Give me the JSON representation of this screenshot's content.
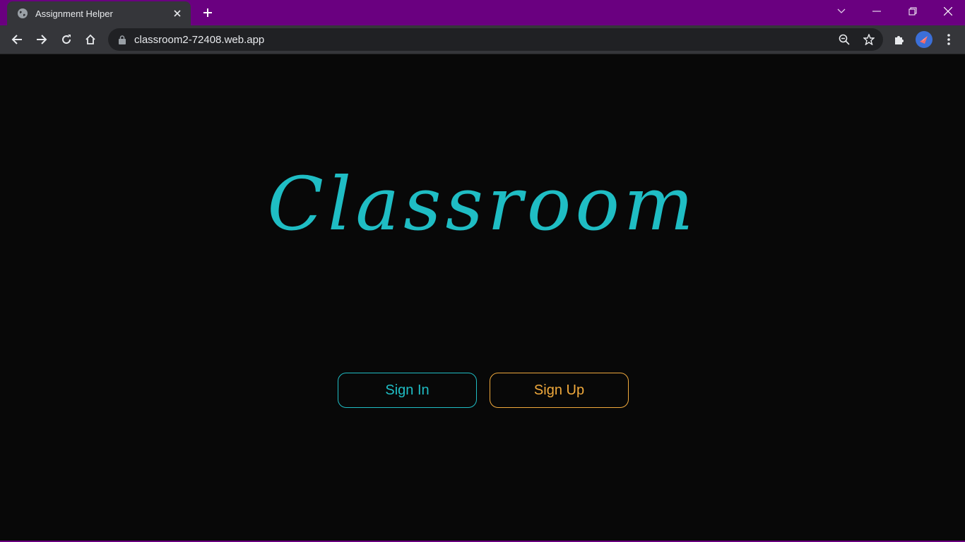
{
  "browser": {
    "tab": {
      "title": "Assignment Helper",
      "favicon": "globe-icon"
    },
    "address_bar": {
      "url": "classroom2-72408.web.app"
    },
    "colors": {
      "frame": "#6a0080",
      "toolbar": "#35363a",
      "omnibox": "#202124"
    }
  },
  "page": {
    "brand": "Classroom",
    "buttons": {
      "sign_in": "Sign In",
      "sign_up": "Sign Up"
    },
    "colors": {
      "background": "#080808",
      "accent_teal": "#1fbdc4",
      "accent_orange": "#f0a93c"
    }
  }
}
